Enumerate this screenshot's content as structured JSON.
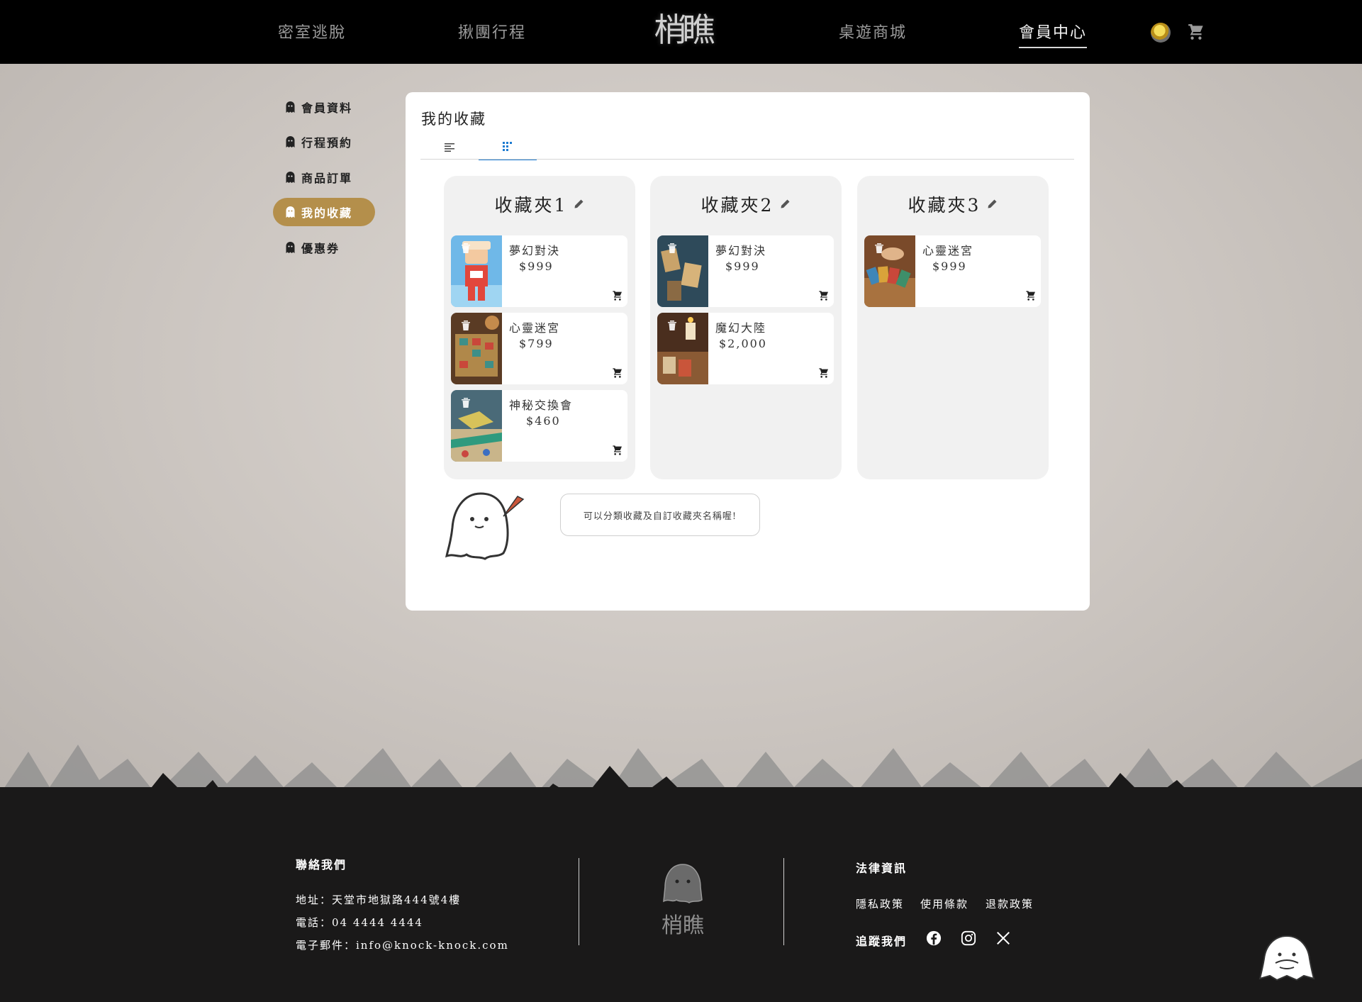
{
  "header": {
    "nav": [
      "密室逃脫",
      "揪團行程",
      "桌遊商城",
      "會員中心"
    ],
    "active": "會員中心",
    "logo_text": "梢瞧"
  },
  "sidebar": {
    "items": [
      {
        "label": "會員資料",
        "active": false
      },
      {
        "label": "行程預約",
        "active": false
      },
      {
        "label": "商品訂單",
        "active": false
      },
      {
        "label": "我的收藏",
        "active": true
      },
      {
        "label": "優惠券",
        "active": false
      }
    ]
  },
  "main": {
    "title": "我的收藏",
    "tabs": [
      {
        "icon": "list-view-icon",
        "active": false
      },
      {
        "icon": "grid-view-icon",
        "active": true
      }
    ],
    "folders": [
      {
        "name": "收藏夾1",
        "items": [
          {
            "name": "夢幻對決",
            "price": "$999",
            "thumb": "toy-figure"
          },
          {
            "name": "心靈迷宮",
            "price": "$799",
            "thumb": "board-game"
          },
          {
            "name": "神秘交換會",
            "price": "$460",
            "thumb": "map-game"
          }
        ]
      },
      {
        "name": "收藏夾2",
        "items": [
          {
            "name": "夢幻對決",
            "price": "$999",
            "thumb": "card-table"
          },
          {
            "name": "魔幻大陸",
            "price": "$2,000",
            "thumb": "candle-cards"
          }
        ]
      },
      {
        "name": "收藏夾3",
        "items": [
          {
            "name": "心靈迷宮",
            "price": "$999",
            "thumb": "hand-cards"
          }
        ]
      }
    ],
    "tip": "可以分類收藏及自訂收藏夾名稱喔!"
  },
  "footer": {
    "contact_title": "聯絡我們",
    "address": "地址：天堂市地獄路444號4樓",
    "phone": "電話：04 4444 4444",
    "email": "電子郵件：info@knock-knock.com",
    "legal_title": "法律資訊",
    "legal_links": [
      "隱私政策",
      "使用條款",
      "退款政策"
    ],
    "follow_title": "追蹤我們",
    "social": [
      "facebook-icon",
      "instagram-icon",
      "x-icon"
    ],
    "logo_text": "梢瞧"
  },
  "colors": {
    "accent": "#b48f4b",
    "header_bg": "#000000",
    "footer_bg": "#1a1919",
    "tab_active": "#1d7bd1"
  }
}
